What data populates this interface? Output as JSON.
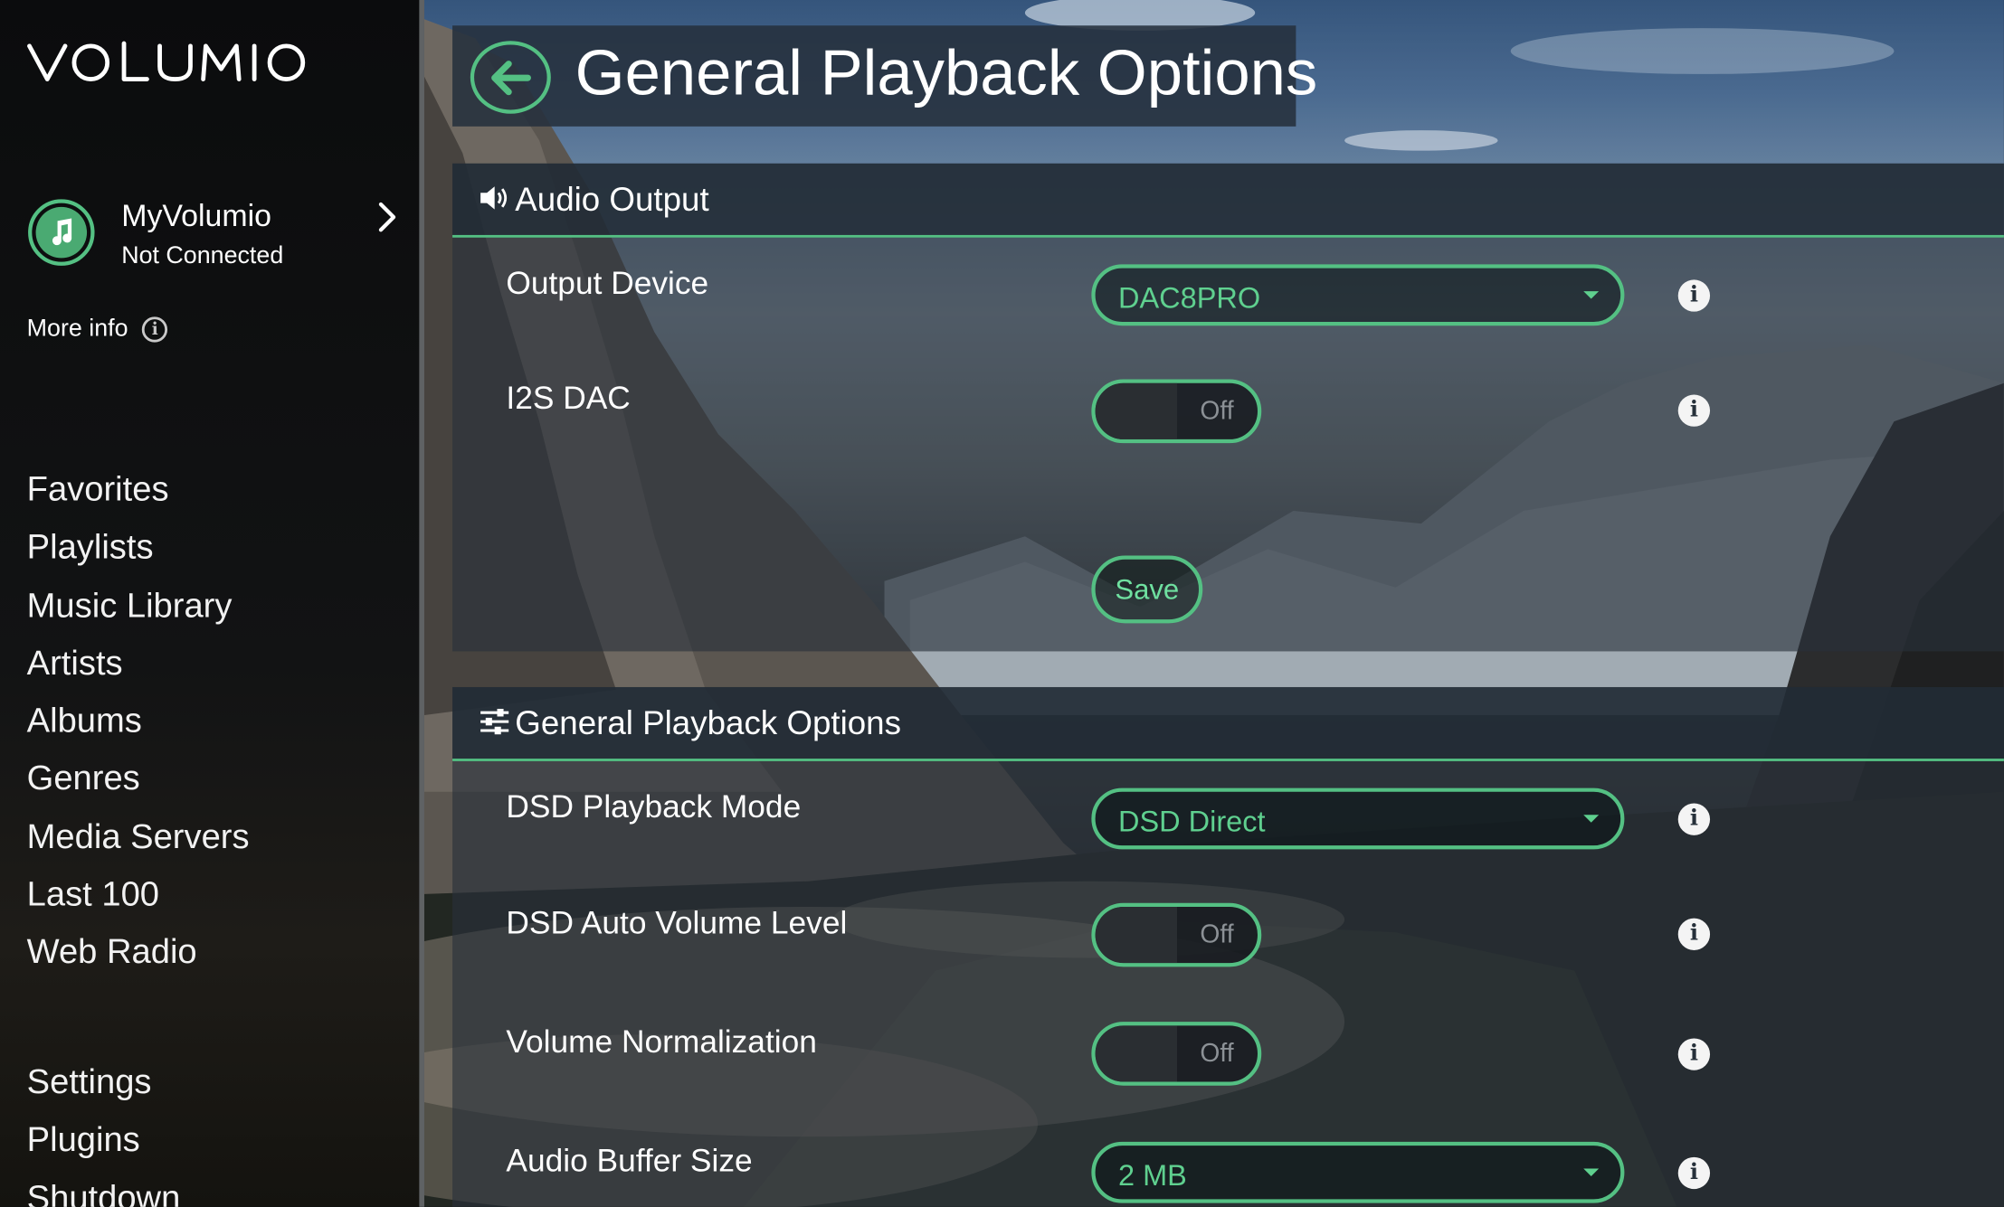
{
  "app": {
    "logo_text": "VOLUMIO"
  },
  "sidebar": {
    "myvolumio": {
      "name": "MyVolumio",
      "status": "Not Connected"
    },
    "more_info": "More info",
    "nav": [
      "Favorites",
      "Playlists",
      "Music Library",
      "Artists",
      "Albums",
      "Genres",
      "Media Servers",
      "Last 100",
      "Web Radio"
    ],
    "system_nav": [
      "Settings",
      "Plugins",
      "Shutdown"
    ]
  },
  "header": {
    "title": "General Playback Options"
  },
  "audio_output": {
    "title": "Audio Output",
    "output_device": {
      "label": "Output Device",
      "value": "DAC8PRO"
    },
    "i2s_dac": {
      "label": "I2S DAC",
      "value": "Off"
    },
    "save_label": "Save"
  },
  "general_playback": {
    "title": "General Playback Options",
    "dsd_mode": {
      "label": "DSD Playback Mode",
      "value": "DSD Direct"
    },
    "dsd_auto_volume": {
      "label": "DSD Auto Volume Level",
      "value": "Off"
    },
    "volume_normalization": {
      "label": "Volume Normalization",
      "value": "Off"
    },
    "audio_buffer": {
      "label": "Audio Buffer Size",
      "value": "2 MB"
    }
  },
  "info_glyph": "i",
  "colors": {
    "accent": "#54c083",
    "accent_text": "#5fd08f",
    "panel_bg": "#28303a"
  },
  "icons": {
    "back": "arrow-left-icon",
    "music": "music-note-icon",
    "speaker": "speaker-icon",
    "sliders": "sliders-icon",
    "info": "info-icon",
    "chevron": "chevron-right-icon"
  }
}
